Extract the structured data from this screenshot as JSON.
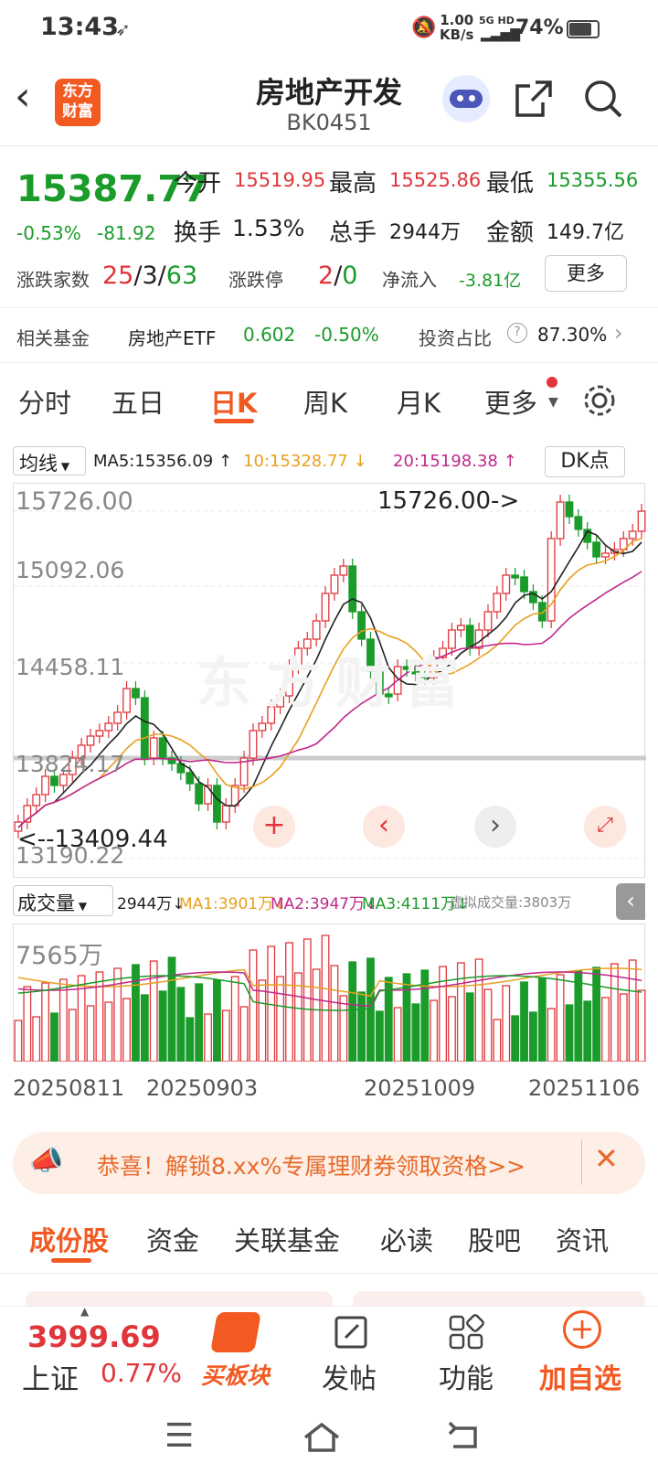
{
  "status": {
    "time": "13:43",
    "net_speed": "1.00",
    "net_unit": "KB/s",
    "signal": "5G HD",
    "battery": "74%"
  },
  "header": {
    "title": "房地产开发",
    "code": "BK0451",
    "logo": "东方财富"
  },
  "quote": {
    "price": "15387.77",
    "change_pct": "-0.53%",
    "change": "-81.92",
    "open_label": "今开",
    "open": "15519.95",
    "high_label": "最高",
    "high": "15525.86",
    "low_label": "最低",
    "low": "15355.56",
    "turnover_label": "换手",
    "turnover": "1.53%",
    "volume_label": "总手",
    "volume": "2944万",
    "amount_label": "金额",
    "amount": "149.7亿",
    "breadth_label": "涨跌家数",
    "breadth_up": "25",
    "breadth_flat": "3",
    "breadth_down": "63",
    "limit_label": "涨跌停",
    "limit_up": "2",
    "limit_down": "0",
    "netflow_label": "净流入",
    "netflow": "-3.81亿",
    "more": "更多"
  },
  "fund": {
    "label": "相关基金",
    "name": "房地产ETF",
    "price": "0.602",
    "change": "-0.50%",
    "ratio_label": "投资占比",
    "ratio": "87.30%"
  },
  "tabs": [
    "分时",
    "五日",
    "日K",
    "周K",
    "月K",
    "更多"
  ],
  "ma": {
    "select": "均线",
    "ma5": "MA5:15356.09",
    "ma10": "10:15328.77",
    "ma20": "20:15198.38",
    "dk": "DK点"
  },
  "axis": {
    "y1": "15726.00",
    "y2": "15092.06",
    "y3": "14458.11",
    "y4": "13824.17",
    "y5": "13190.22",
    "max_label": "15726.00->",
    "min_label": "<--13409.44"
  },
  "vol": {
    "select": "成交量",
    "v": "2944万",
    "ma1": "MA1:3901万",
    "ma2": "MA2:3947万",
    "ma3": "MA3:4111万",
    "virtual": "虚拟成交量:3803万",
    "ymax": "7565万"
  },
  "dates": [
    "20250811",
    "20250903",
    "20251009",
    "20251106"
  ],
  "ad": "恭喜！解锁8.xx%专属理财券领取资格>>",
  "bottom_tabs": [
    "成份股",
    "资金",
    "关联基金",
    "必读",
    "股吧",
    "资讯"
  ],
  "bottom": {
    "index_value": "3999.69",
    "index_name": "上证",
    "index_pct": "0.77%",
    "buy": "买板块",
    "post": "发帖",
    "func": "功能",
    "add": "加自选"
  },
  "colors": {
    "up": "#e0353a",
    "down": "#1a9b2a",
    "accent": "#f25a22"
  }
}
